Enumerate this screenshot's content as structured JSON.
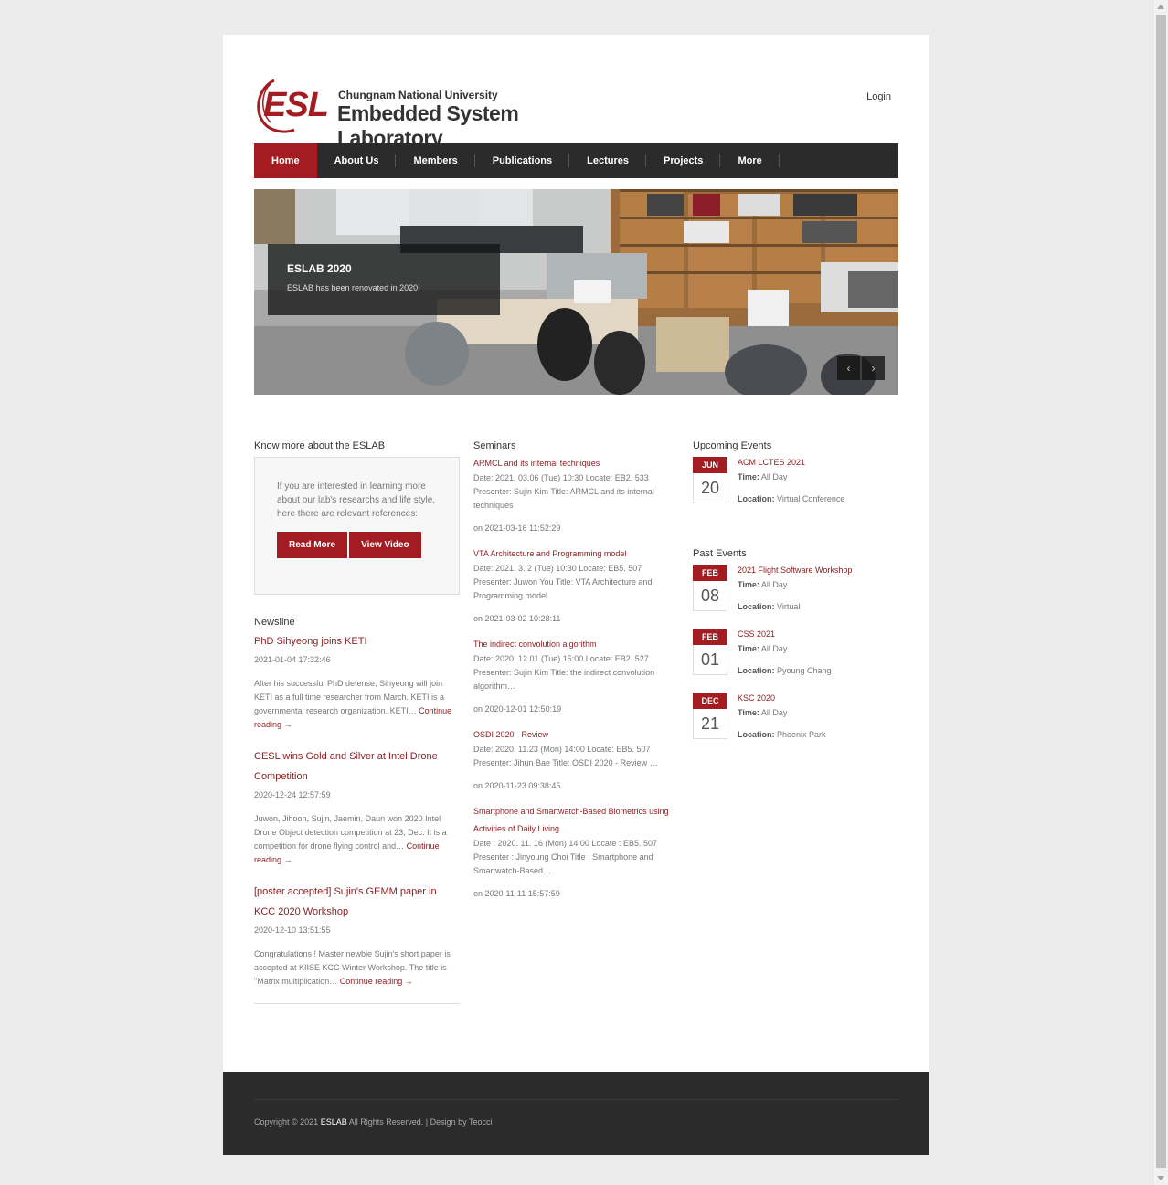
{
  "header": {
    "logo_mark": "ESL",
    "university": "Chungnam National University",
    "lab_name": "Embedded System Laboratory",
    "login": "Login"
  },
  "nav": [
    "Home",
    "About Us",
    "Members",
    "Publications",
    "Lectures",
    "Projects",
    "More"
  ],
  "slider": {
    "title": "ESLAB 2020",
    "subtitle": "ESLAB has been renovated in 2020!",
    "prev": "‹",
    "next": "›"
  },
  "know": {
    "heading": "Know more about the ESLAB",
    "text": "If you are interested in learning more about our lab's researchs and life style, here there are relevant references:",
    "read_more": "Read More",
    "view_video": "View Video"
  },
  "newsline": {
    "heading": "Newsline",
    "items": [
      {
        "title": "PhD Sihyeong joins KETI",
        "date": "2021-01-04 17:32:46",
        "body": "After his successful PhD defense, Sihyeong will join KETI as a full time researcher from March. KETI is a governmental research organization. KETI…",
        "more": "Continue reading →"
      },
      {
        "title": "CESL wins Gold and Silver at Intel Drone Competition",
        "date": "2020-12-24 12:57:59",
        "body": "Juwon, Jihoon, Sujin, Jaemin, Daun won 2020 Intel Drone Object detection competition at 23, Dec. It is a competition for drone flying control and…",
        "more": "Continue reading →"
      },
      {
        "title": "[poster accepted] Sujin's GEMM paper in KCC 2020 Workshop",
        "date": "2020-12-10 13:51:55",
        "body": "Congratulations ! Master newbie Sujin's short paper is accepted at KIISE KCC Winter Workshop. The title is \"Matrix multiplication…",
        "more": "Continue reading →"
      }
    ]
  },
  "seminars": {
    "heading": "Seminars",
    "items": [
      {
        "title": "ARMCL and its internal techniques",
        "body": "Date: 2021. 03.06 (Tue) 10:30 Locate: EB2. 533 Presenter: Sujin Kim Title: ARMCL and its internal techniques",
        "date": "on 2021-03-16 11:52:29"
      },
      {
        "title": "VTA Architecture and Programming model",
        "body": "Date: 2021. 3. 2 (Tue) 10:30 Locate: EB5. 507 Presenter: Juwon You Title: VTA Architecture and Programming model",
        "date": "on 2021-03-02 10:28:11"
      },
      {
        "title": "The indirect convolution algorithm",
        "body": "Date: 2020. 12.01 (Tue) 15:00 Locate: EB2. 527 Presenter: Sujin Kim Title: the indirect convolution algorithm…",
        "date": "on 2020-12-01 12:50:19"
      },
      {
        "title": "OSDI 2020 - Review",
        "body": "Date: 2020. 11.23 (Mon) 14:00 Locate: EB5. 507 Presenter: Jihun Bae Title: OSDI 2020 - Review …",
        "date": "on 2020-11-23 09:38:45"
      },
      {
        "title": "Smartphone and Smartwatch-Based Biometrics using Activities of Daily Living",
        "body": "Date : 2020. 11. 16 (Mon) 14:00 Locate : EB5. 507 Presenter : Jinyoung Choi   Title : Smartphone and Smartwatch-Based…",
        "date": "on 2020-11-11 15:57:59"
      }
    ]
  },
  "events": {
    "upcoming_heading": "Upcoming Events",
    "past_heading": "Past Events",
    "time_label": "Time:",
    "location_label": "Location:",
    "upcoming": [
      {
        "month": "JUN",
        "day": "20",
        "title": "ACM LCTES 2021",
        "time": "All Day",
        "location": "Virtual Conference"
      }
    ],
    "past": [
      {
        "month": "FEB",
        "day": "08",
        "title": "2021 Flight Software Workshop",
        "time": "All Day",
        "location": "Virtual"
      },
      {
        "month": "FEB",
        "day": "01",
        "title": "CSS 2021",
        "time": "All Day",
        "location": "Pyoung Chang"
      },
      {
        "month": "DEC",
        "day": "21",
        "title": "KSC 2020",
        "time": "All Day",
        "location": "Phoenix Park"
      }
    ]
  },
  "footer": {
    "copy_pre": "Copyright © 2021",
    "brand": "ESLAB",
    "copy_post": "All Rights Reserved.  |  Design by Teocci"
  },
  "colors": {
    "accent": "#a31c22",
    "nav_bg": "#2b2b2b",
    "link": "#8c1c1f"
  }
}
